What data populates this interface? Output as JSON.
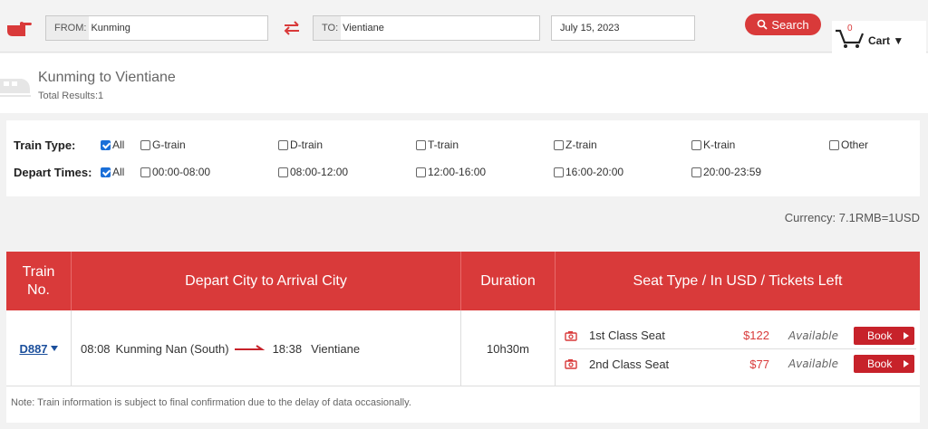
{
  "search": {
    "from_label": "FROM:",
    "from_value": "Kunming",
    "to_label": "TO:",
    "to_value": "Vientiane",
    "date_value": "July 15, 2023",
    "search_label": "Search"
  },
  "cart": {
    "count": "0",
    "label": "Cart ▼"
  },
  "route": {
    "title": "Kunming to Vientiane",
    "total": "Total Results:1"
  },
  "filters": {
    "train_type_label": "Train Type:",
    "train_types": [
      "All",
      "G-train",
      "D-train",
      "T-train",
      "Z-train",
      "K-train",
      "Other"
    ],
    "depart_label": "Depart Times:",
    "depart_times": [
      "All",
      "00:00-08:00",
      "08:00-12:00",
      "12:00-16:00",
      "16:00-20:00",
      "20:00-23:59"
    ]
  },
  "currency": "Currency: 7.1RMB=1USD",
  "table": {
    "headers": {
      "train_no_line1": "Train",
      "train_no_line2": "No.",
      "route": "Depart City to Arrival City",
      "duration": "Duration",
      "seats": "Seat Type / In USD / Tickets Left"
    },
    "row": {
      "train_no": "D887",
      "depart_time": "08:08",
      "depart_city": "Kunming Nan (South)",
      "arrive_time": "18:38",
      "arrive_city": "Vientiane",
      "duration": "10h30m",
      "seats": [
        {
          "name": "1st Class Seat",
          "price": "$122",
          "status": "Available",
          "book": "Book"
        },
        {
          "name": "2nd Class Seat",
          "price": "$77",
          "status": "Available",
          "book": "Book"
        }
      ]
    },
    "note": "Note: Train information is subject to final confirmation due to the delay of data occasionally."
  },
  "colors": {
    "accent": "#d93a3a",
    "link": "#1b4f9c",
    "book": "#c7222a"
  }
}
